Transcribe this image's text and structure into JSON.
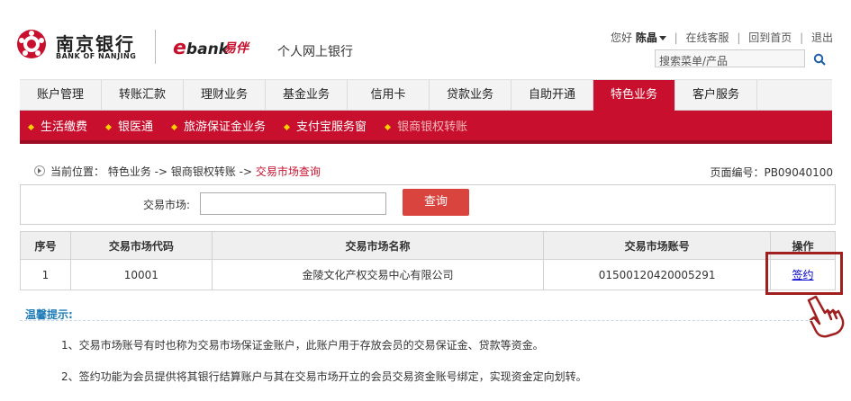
{
  "header": {
    "bank_name_cn": "南京银行",
    "bank_name_en": "BANK OF NANJING",
    "ebank_brand": "bank",
    "ebank_brand_prefix": "e",
    "ebank_brand_cn": "易",
    "ebank_brand_cn2": "伴",
    "service_title": "个人网上银行",
    "greeting": "您好",
    "user_name": "陈晶",
    "links": [
      "在线客服",
      "回到首页",
      "退出"
    ],
    "search_placeholder": "搜索菜单/产品"
  },
  "nav": {
    "items": [
      "账户管理",
      "转账汇款",
      "理财业务",
      "基金业务",
      "信用卡",
      "贷款业务",
      "自助开通",
      "特色业务",
      "客户服务"
    ],
    "active_index": 7
  },
  "subnav": {
    "items": [
      "生活缴费",
      "银医通",
      "旅游保证金业务",
      "支付宝服务窗",
      "银商银权转账"
    ]
  },
  "breadcrumb": {
    "label": "当前位置：",
    "path": "特色业务 -> 银商银权转账 ->",
    "current": "交易市场查询"
  },
  "page_number": {
    "label": "页面编号：",
    "value": "PB09040100"
  },
  "query": {
    "label": "交易市场:",
    "button_label": "查询"
  },
  "table": {
    "headers": [
      "序号",
      "交易市场代码",
      "交易市场名称",
      "交易市场账号",
      "操作"
    ],
    "rows": [
      [
        "1",
        "10001",
        "金陵文化产权交易中心有限公司",
        "01500120420005291",
        "签约"
      ]
    ]
  },
  "tips": {
    "title": "温馨提示:",
    "items": [
      "1、交易市场账号有时也称为交易市场保证金账户，此账户用于存放会员的交易保证金、贷款等资金。",
      "2、签约功能为会员提供将其银行结算账户与其在交易市场开立的会员交易资金账号绑定，实现资金定向划转。"
    ]
  },
  "colors": {
    "brand_red": "#c8102e",
    "link_blue": "#0000cc",
    "tips_blue": "#1f7db8",
    "button_red": "#d9443f"
  }
}
